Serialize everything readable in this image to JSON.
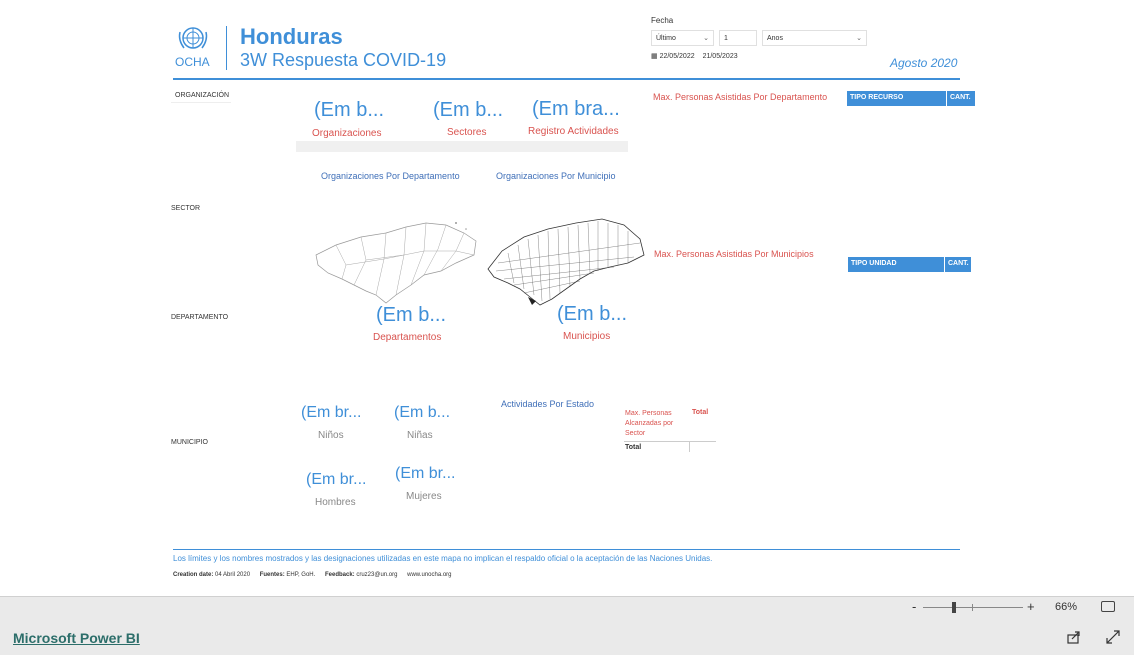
{
  "header": {
    "logo_text": "OCHA",
    "title": "Honduras",
    "subtitle": "3W Respuesta COVID-19",
    "report_date": "Agosto 2020"
  },
  "date_filter": {
    "label": "Fecha",
    "mode_value": "Último",
    "count_value": "1",
    "unit_value": "Anos",
    "range_start": "22/05/2022",
    "range_end": "21/05/2023"
  },
  "slicers": {
    "organizacion": "ORGANIZACIÓN",
    "sector": "SECTOR",
    "departamento": "DEPARTAMENTO",
    "municipio": "MUNICIPIO"
  },
  "kpis": {
    "organizaciones": {
      "value": "(Em b...",
      "label": "Organizaciones"
    },
    "sectores": {
      "value": "(Em b...",
      "label": "Sectores"
    },
    "registro": {
      "value": "(Em bra...",
      "label": "Registro Actividades"
    },
    "departamentos": {
      "value": "(Em b...",
      "label": "Departamentos"
    },
    "municipios": {
      "value": "(Em b...",
      "label": "Municipios"
    },
    "ninos": {
      "value": "(Em br...",
      "label": "Niños"
    },
    "ninas": {
      "value": "(Em b...",
      "label": "Niñas"
    },
    "hombres": {
      "value": "(Em br...",
      "label": "Hombres"
    },
    "mujeres": {
      "value": "(Em br...",
      "label": "Mujeres"
    }
  },
  "visual_titles": {
    "org_por_depto": "Organizaciones Por Departamento",
    "org_por_muni": "Organizaciones Por Municipio",
    "act_por_estado": "Actividades Por Estado",
    "max_por_depto": "Max. Personas Asistidas Por Departamento",
    "max_por_muni": "Max. Personas Asistidas Por Municipios"
  },
  "tables": {
    "recurso": {
      "col1": "TIPO RECURSO",
      "col2": "CANT."
    },
    "unidad": {
      "col1": "TIPO UNIDAD",
      "col2": "CANT."
    },
    "sector_matrix": {
      "col1": "Max. Personas Alcanzadas por Sector",
      "col2": "Total",
      "total_row": "Total"
    }
  },
  "footer": {
    "disclaimer": "Los límites y los nombres mostrados y las designaciones utilizadas en este mapa no implican el respaldo oficial o la aceptación de las Naciones Unidas.",
    "creation_label": "Creation date:",
    "creation_value": "04 Abril 2020",
    "fuentes_label": "Fuentes:",
    "fuentes_value": "EHP, GoH.",
    "feedback_label": "Feedback:",
    "feedback_value": "cruz23@un.org",
    "website": "www.unocha.org"
  },
  "status": {
    "zoom_percent": "66%",
    "zoom_minus": "-",
    "zoom_plus": "+"
  },
  "bottom": {
    "brand_link": "Microsoft Power BI"
  }
}
